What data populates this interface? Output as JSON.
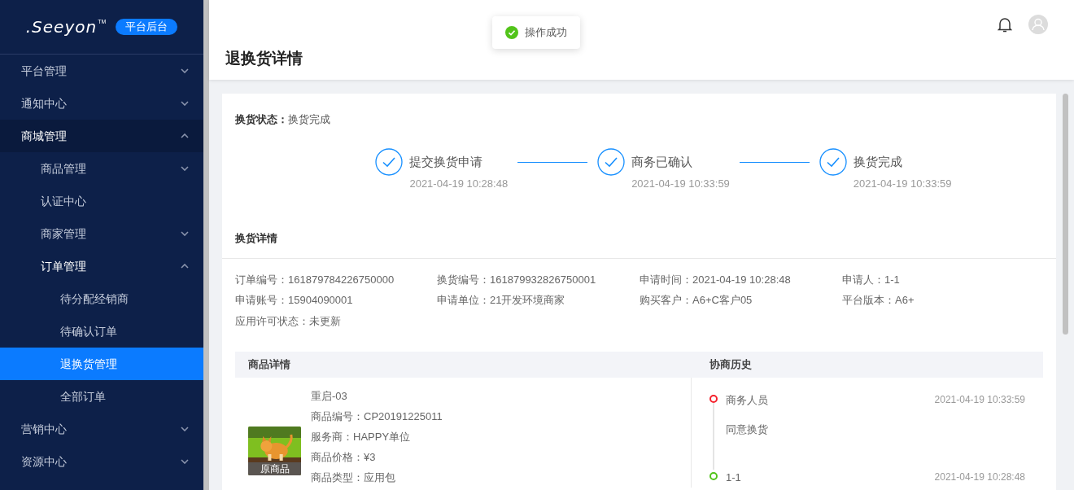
{
  "sidebar": {
    "logo": ".Seeyon",
    "logo_mark": "TM",
    "badge": "平台后台",
    "items": [
      {
        "label": "平台管理",
        "expanded": false,
        "selected": false
      },
      {
        "label": "通知中心",
        "expanded": false,
        "selected": false
      },
      {
        "label": "商城管理",
        "expanded": true,
        "selected": false,
        "children": [
          {
            "label": "商品管理",
            "expanded": false,
            "selected": false
          },
          {
            "label": "认证中心",
            "selected": false
          },
          {
            "label": "商家管理",
            "expanded": false,
            "selected": false
          },
          {
            "label": "订单管理",
            "expanded": true,
            "selected": false,
            "children": [
              {
                "label": "待分配经销商",
                "selected": false
              },
              {
                "label": "待确认订单",
                "selected": false
              },
              {
                "label": "退换货管理",
                "selected": true
              },
              {
                "label": "全部订单",
                "selected": false
              }
            ]
          }
        ]
      },
      {
        "label": "营销中心",
        "expanded": false,
        "selected": false
      },
      {
        "label": "资源中心",
        "expanded": false,
        "selected": false
      }
    ]
  },
  "toast": {
    "text": "操作成功"
  },
  "header": {
    "title": "退换货详情"
  },
  "status": {
    "label": "换货状态：",
    "value": "换货完成"
  },
  "steps": [
    {
      "label": "提交换货申请",
      "time": "2021-04-19 10:28:48",
      "done": true
    },
    {
      "label": "商务已确认",
      "time": "2021-04-19 10:33:59",
      "done": true
    },
    {
      "label": "换货完成",
      "time": "2021-04-19 10:33:59",
      "done": true
    }
  ],
  "details": {
    "title": "换货详情",
    "fields": [
      {
        "label": "订单编号：",
        "value": "161879784226750000"
      },
      {
        "label": "换货编号：",
        "value": "161879932826750001"
      },
      {
        "label": "申请时间：",
        "value": "2021-04-19 10:28:48"
      },
      {
        "label": "申请人：",
        "value": "1-1"
      },
      {
        "label": "申请账号：",
        "value": "15904090001"
      },
      {
        "label": "申请单位：",
        "value": "21开发环境商家"
      },
      {
        "label": "购买客户：",
        "value": "A6+C客户05"
      },
      {
        "label": "平台版本：",
        "value": "A6+"
      },
      {
        "label": "应用许可状态：",
        "value": "未更新"
      }
    ]
  },
  "goods": {
    "heading": "商品详情",
    "image_caption": "原商品",
    "name": "重启-03",
    "lines": [
      {
        "label": "商品编号：",
        "value": "CP20191225011"
      },
      {
        "label": "服务商：",
        "value": "HAPPY单位"
      },
      {
        "label": "商品价格：",
        "value": "¥3"
      },
      {
        "label": "商品类型：",
        "value": "应用包"
      }
    ]
  },
  "history": {
    "heading": "协商历史",
    "items": [
      {
        "actor": "商务人员",
        "time": "2021-04-19 10:33:59",
        "note": "同意换货",
        "color": "#f5222d"
      },
      {
        "actor": "1-1",
        "time": "2021-04-19 10:28:48",
        "color": "#52c41a"
      }
    ]
  }
}
